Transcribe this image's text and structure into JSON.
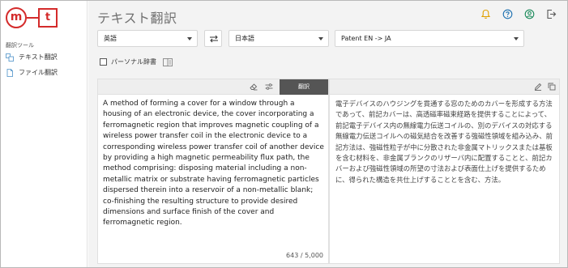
{
  "logo": {
    "left_letter": "m",
    "right_letter": "t"
  },
  "sidebar": {
    "section_label": "翻訳ツール",
    "items": [
      {
        "label": "テキスト翻訳",
        "icon": "translate-icon"
      },
      {
        "label": "ファイル翻訳",
        "icon": "file-icon"
      }
    ]
  },
  "header": {
    "title": "テキスト翻訳",
    "icons": [
      "bell-icon",
      "help-icon",
      "user-icon",
      "logout-icon"
    ],
    "bell_color": "#e0a000"
  },
  "controls": {
    "source_language": "英語",
    "target_language": "日本語",
    "model": "Patent EN -> JA",
    "personal_dictionary_label": "パーソナル辞書",
    "personal_dictionary_checked": false
  },
  "source_panel": {
    "text": "A method of forming a cover for a window through a housing of an electronic device, the cover incorporating a ferromagnetic region that improves magnetic coupling of a wireless power transfer coil in the electronic device to a corresponding wireless power transfer coil of another device by providing a high magnetic permeability flux path, the method comprising: disposing material including a non-metallic matrix or substrate having ferromagnetic particles dispersed therein into a reservoir of a non-metallic blank; co-finishing the resulting structure to provide desired dimensions and surface finish of the cover and ferromagnetic region.",
    "char_count": "643 / 5,000",
    "translate_label": "翻訳"
  },
  "target_panel": {
    "text": "電子デバイスのハウジングを貫通する窓のためのカバーを形成する方法であって、前記カバーは、高透磁率磁束経路を提供することによって、前記電子デバイス内の無線電力伝送コイルの、別のデバイスの対応する無線電力伝送コイルへの磁気結合を改善する強磁性領域を組み込み、前記方法は、強磁性粒子が中に分散された非金属マトリックスまたは基板を含む材料を、非金属ブランクのリザーバ内に配置することと、前記カバーおよび強磁性領域の所望の寸法および表面仕上げを提供するために、得られた構造を共仕上げすることとを含む、方法。"
  }
}
